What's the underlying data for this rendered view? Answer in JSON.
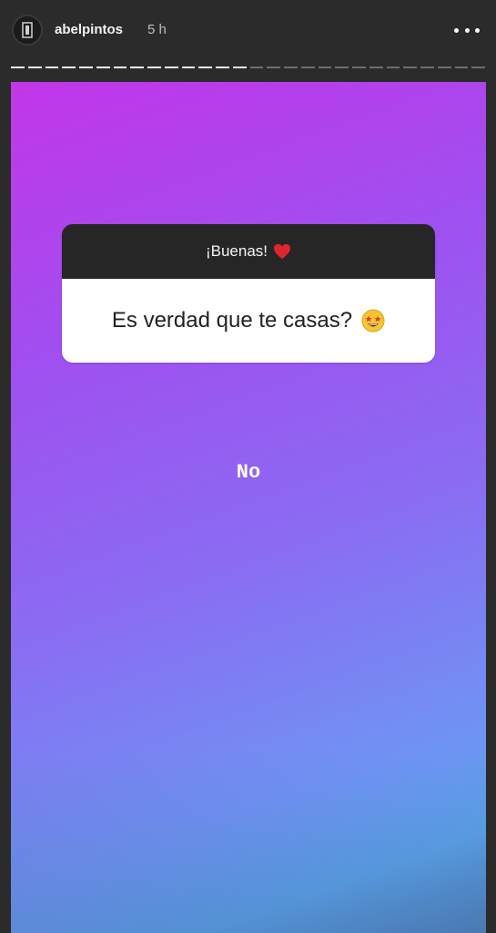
{
  "header": {
    "username": "abelpintos",
    "time": "5 h",
    "more_icon": "more-horizontal-icon",
    "avatar_icon": "profile-avatar"
  },
  "progress": {
    "segments_total": 28,
    "segments_viewed": 14
  },
  "story": {
    "gradient_colors": [
      "#c236e8",
      "#8a6cf2",
      "#5aa3ea"
    ],
    "question_sticker": {
      "prompt": "¡Buenas!",
      "prompt_icon": "red-heart-icon",
      "question": "Es verdad que te casas?",
      "question_icon": "star-struck-emoji-icon"
    },
    "answer": "No"
  }
}
